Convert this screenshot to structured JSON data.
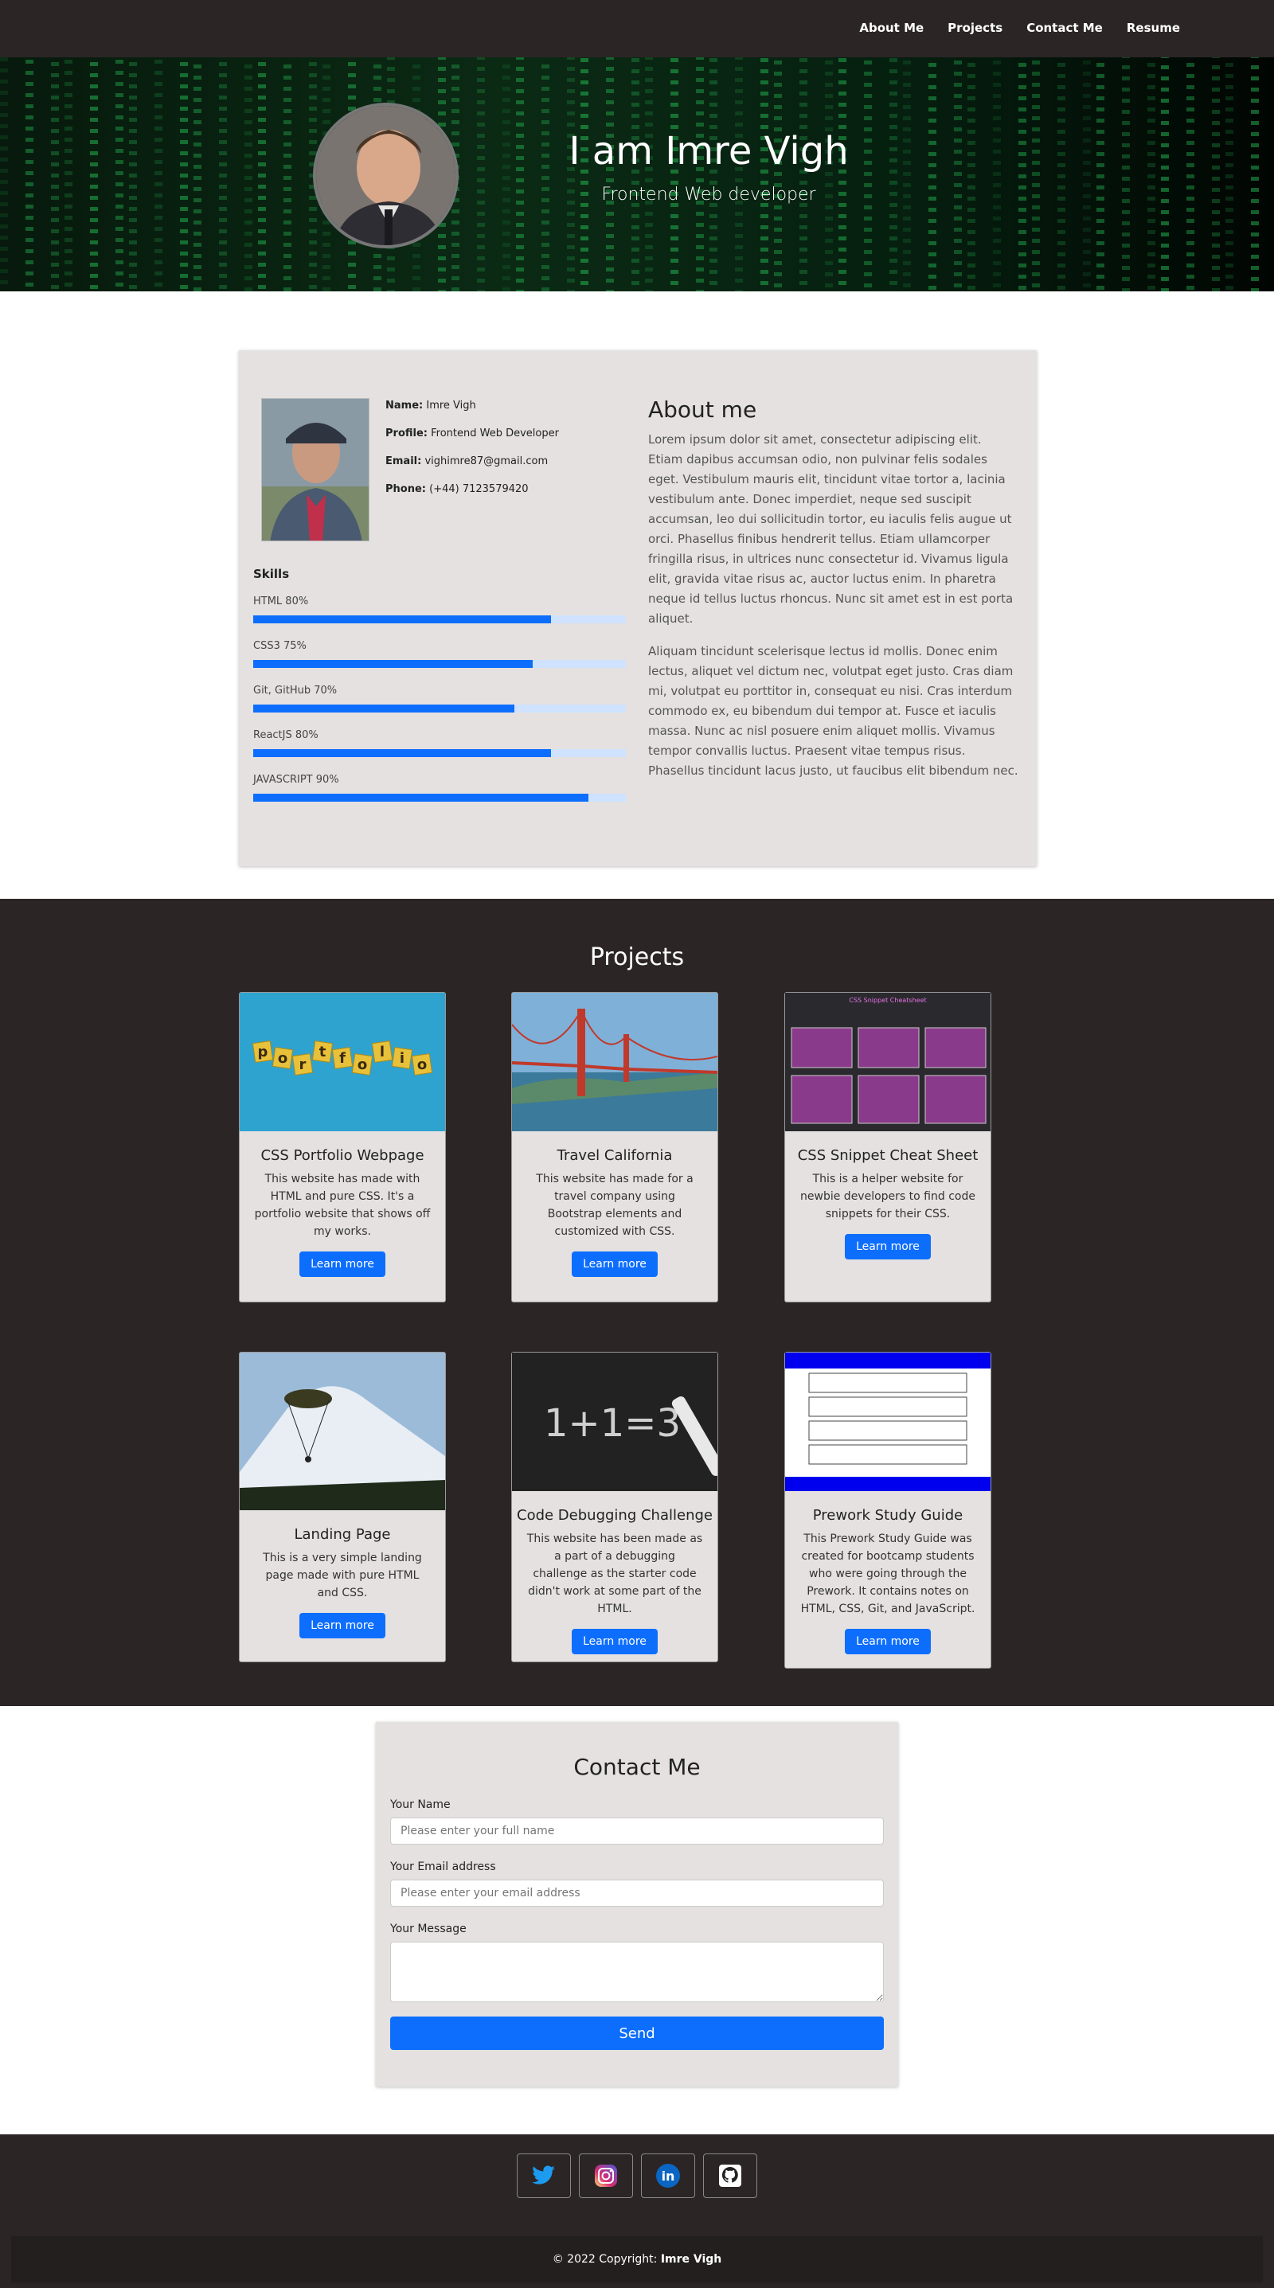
{
  "nav": {
    "items": [
      "About Me",
      "Projects",
      "Contact Me",
      "Resume"
    ]
  },
  "hero": {
    "title": "I am Imre Vigh",
    "subtitle": "Frontend Web developer"
  },
  "about": {
    "info": [
      {
        "label": "Name:",
        "value": "Imre Vigh"
      },
      {
        "label": "Profile:",
        "value": "Frontend Web Developer"
      },
      {
        "label": "Email:",
        "value": "vighimre87@gmail.com"
      },
      {
        "label": "Phone:",
        "value": "(+44) 7123579420"
      }
    ],
    "skills_title": "Skills",
    "skills": [
      {
        "label": "HTML 80%",
        "percent": 80
      },
      {
        "label": "CSS3 75%",
        "percent": 75
      },
      {
        "label": "Git, GitHub 70%",
        "percent": 70
      },
      {
        "label": "ReactJS 80%",
        "percent": 80
      },
      {
        "label": "JAVASCRIPT 90%",
        "percent": 90
      }
    ],
    "title": "About me",
    "paragraphs": [
      "Lorem ipsum dolor sit amet, consectetur adipiscing elit. Etiam dapibus accumsan odio, non pulvinar felis sodales eget. Vestibulum mauris elit, tincidunt vitae tortor a, lacinia vestibulum ante. Donec imperdiet, neque sed suscipit accumsan, leo dui sollicitudin tortor, eu iaculis felis augue ut orci. Phasellus finibus hendrerit tellus. Etiam ullamcorper fringilla risus, in ultrices nunc consectetur id. Vivamus ligula elit, gravida vitae risus ac, auctor luctus enim. In pharetra neque id tellus luctus rhoncus. Nunc sit amet est in est porta aliquet.",
      "Aliquam tincidunt scelerisque lectus id mollis. Donec enim lectus, aliquet vel dictum nec, volutpat eget justo. Cras diam mi, volutpat eu porttitor in, consequat eu nisi. Cras interdum commodo ex, eu bibendum dui tempor at. Fusce et iaculis massa. Nunc ac nisl posuere enim aliquet mollis. Vivamus tempor convallis luctus. Praesent vitae tempus risus. Phasellus tincidunt lacus justo, ut faucibus elit bibendum nec."
    ]
  },
  "projects": {
    "title": "Projects",
    "button_label": "Learn more",
    "items": [
      {
        "title": "CSS Portfolio Webpage",
        "desc": "This website has made with HTML and pure CSS. It's a portfolio website that shows off my works.",
        "tile_text": "portfolio"
      },
      {
        "title": "Travel California",
        "desc": "This website has made for a travel company using Bootstrap elements and customized with CSS."
      },
      {
        "title": "CSS Snippet Cheat Sheet",
        "desc": "This is a helper website for newbie developers to find code snippets for their CSS.",
        "shot_title": "CSS Snippet Cheatsheet"
      },
      {
        "title": "Landing Page",
        "desc": "This is a very simple landing page made with pure HTML and CSS."
      },
      {
        "title": "Code Debugging Challenge",
        "desc": "This website has been made as a part of a debugging challenge as the starter code didn't work at some part of the HTML.",
        "chalk_text": "1+1=3"
      },
      {
        "title": "Prework Study Guide",
        "desc": "This Prework Study Guide was created for bootcamp students who were going through the Prework. It contains notes on HTML, CSS, Git, and JavaScript."
      }
    ]
  },
  "contact": {
    "title": "Contact Me",
    "name_label": "Your Name",
    "name_placeholder": "Please enter your full name",
    "email_label": "Your Email address",
    "email_placeholder": "Please enter your email address",
    "message_label": "Your Message",
    "send_label": "Send"
  },
  "footer": {
    "socials": [
      "twitter-icon",
      "instagram-icon",
      "linkedin-icon",
      "github-icon"
    ],
    "copyright_prefix": "© 2022 Copyright:",
    "copyright_name": "Imre Vigh"
  },
  "colors": {
    "nav_bg": "#2b2525",
    "accent": "#0d6efd",
    "card_bg": "#e4e1e0"
  }
}
